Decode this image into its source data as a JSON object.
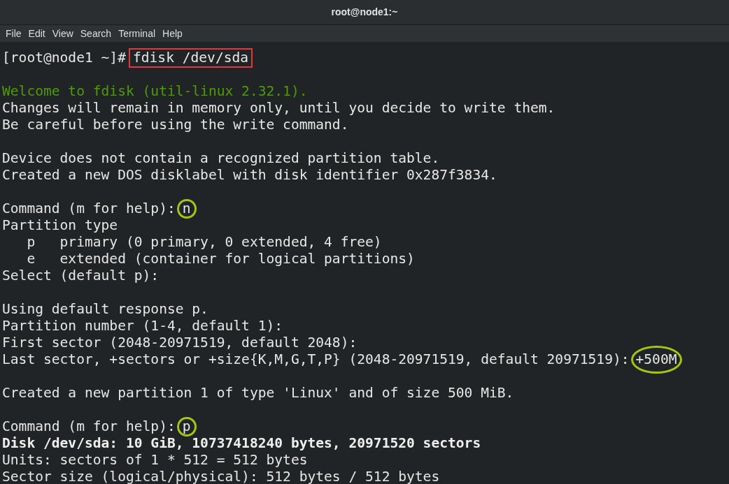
{
  "window": {
    "title": "root@node1:~"
  },
  "menu": [
    "File",
    "Edit",
    "View",
    "Search",
    "Terminal",
    "Help"
  ],
  "lines": [
    {
      "kind": "prompt",
      "text": "[root@node1 ~]#",
      "input": "fdisk /dev/sda",
      "annotation": {
        "kind": "box"
      }
    },
    {
      "kind": "blank"
    },
    {
      "kind": "green",
      "text": "Welcome to fdisk (util-linux 2.32.1)."
    },
    {
      "kind": "text",
      "text": "Changes will remain in memory only, until you decide to write them."
    },
    {
      "kind": "text",
      "text": "Be careful before using the write command."
    },
    {
      "kind": "blank"
    },
    {
      "kind": "text",
      "text": "Device does not contain a recognized partition table."
    },
    {
      "kind": "text",
      "text": "Created a new DOS disklabel with disk identifier 0x287f3834."
    },
    {
      "kind": "blank"
    },
    {
      "kind": "prompt",
      "text": "Command (m for help):",
      "input": "n",
      "annotation": {
        "kind": "circle"
      }
    },
    {
      "kind": "text",
      "text": "Partition type"
    },
    {
      "kind": "text",
      "text": "   p   primary (0 primary, 0 extended, 4 free)"
    },
    {
      "kind": "text",
      "text": "   e   extended (container for logical partitions)"
    },
    {
      "kind": "text",
      "text": "Select (default p):"
    },
    {
      "kind": "blank"
    },
    {
      "kind": "text",
      "text": "Using default response p."
    },
    {
      "kind": "text",
      "text": "Partition number (1-4, default 1):"
    },
    {
      "kind": "text",
      "text": "First sector (2048-20971519, default 2048):"
    },
    {
      "kind": "prompt",
      "text": "Last sector, +sectors or +size{K,M,G,T,P} (2048-20971519, default 20971519):",
      "input": "+500M",
      "annotation": {
        "kind": "ellipse"
      }
    },
    {
      "kind": "blank"
    },
    {
      "kind": "text",
      "text": "Created a new partition 1 of type 'Linux' and of size 500 MiB."
    },
    {
      "kind": "blank"
    },
    {
      "kind": "prompt",
      "text": "Command (m for help):",
      "input": "p",
      "annotation": {
        "kind": "circle"
      }
    },
    {
      "kind": "bold",
      "text": "Disk /dev/sda: 10 GiB, 10737418240 bytes, 20971520 sectors"
    },
    {
      "kind": "text",
      "text": "Units: sectors of 1 * 512 = 512 bytes"
    },
    {
      "kind": "text",
      "text": "Sector size (logical/physical): 512 bytes / 512 bytes"
    }
  ]
}
